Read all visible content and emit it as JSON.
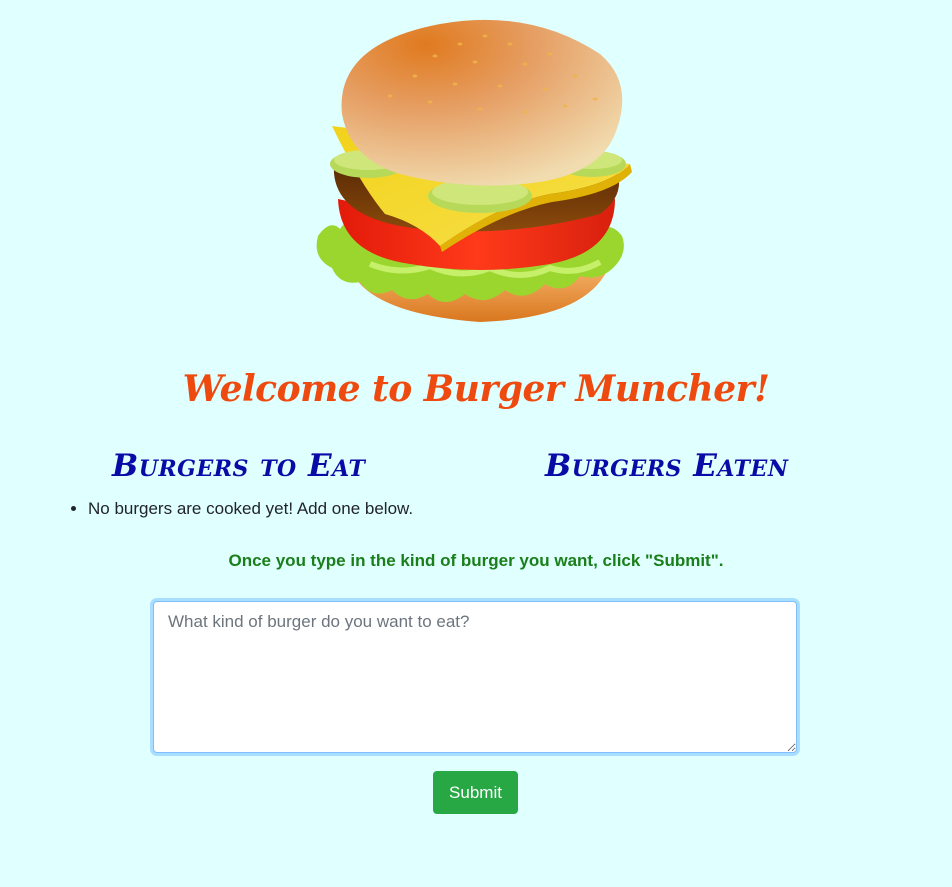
{
  "header": {
    "logo_icon": "hamburger-icon",
    "welcome_text": "Welcome to Burger Muncher!"
  },
  "columns": {
    "to_eat_title": "Burgers to Eat",
    "eaten_title": "Burgers Eaten"
  },
  "to_eat_list": {
    "empty_message": "No burgers are cooked yet! Add one below."
  },
  "form": {
    "instructions": "Once you type in the kind of burger you want, click \"Submit\".",
    "placeholder": "What kind of burger do you want to eat?",
    "submit_label": "Submit"
  },
  "colors": {
    "background": "#e0ffff",
    "welcome": "#ee4a10",
    "column_heading": "#0a0aa6",
    "instructions": "#1a7f1a",
    "submit_button": "#28a745"
  }
}
